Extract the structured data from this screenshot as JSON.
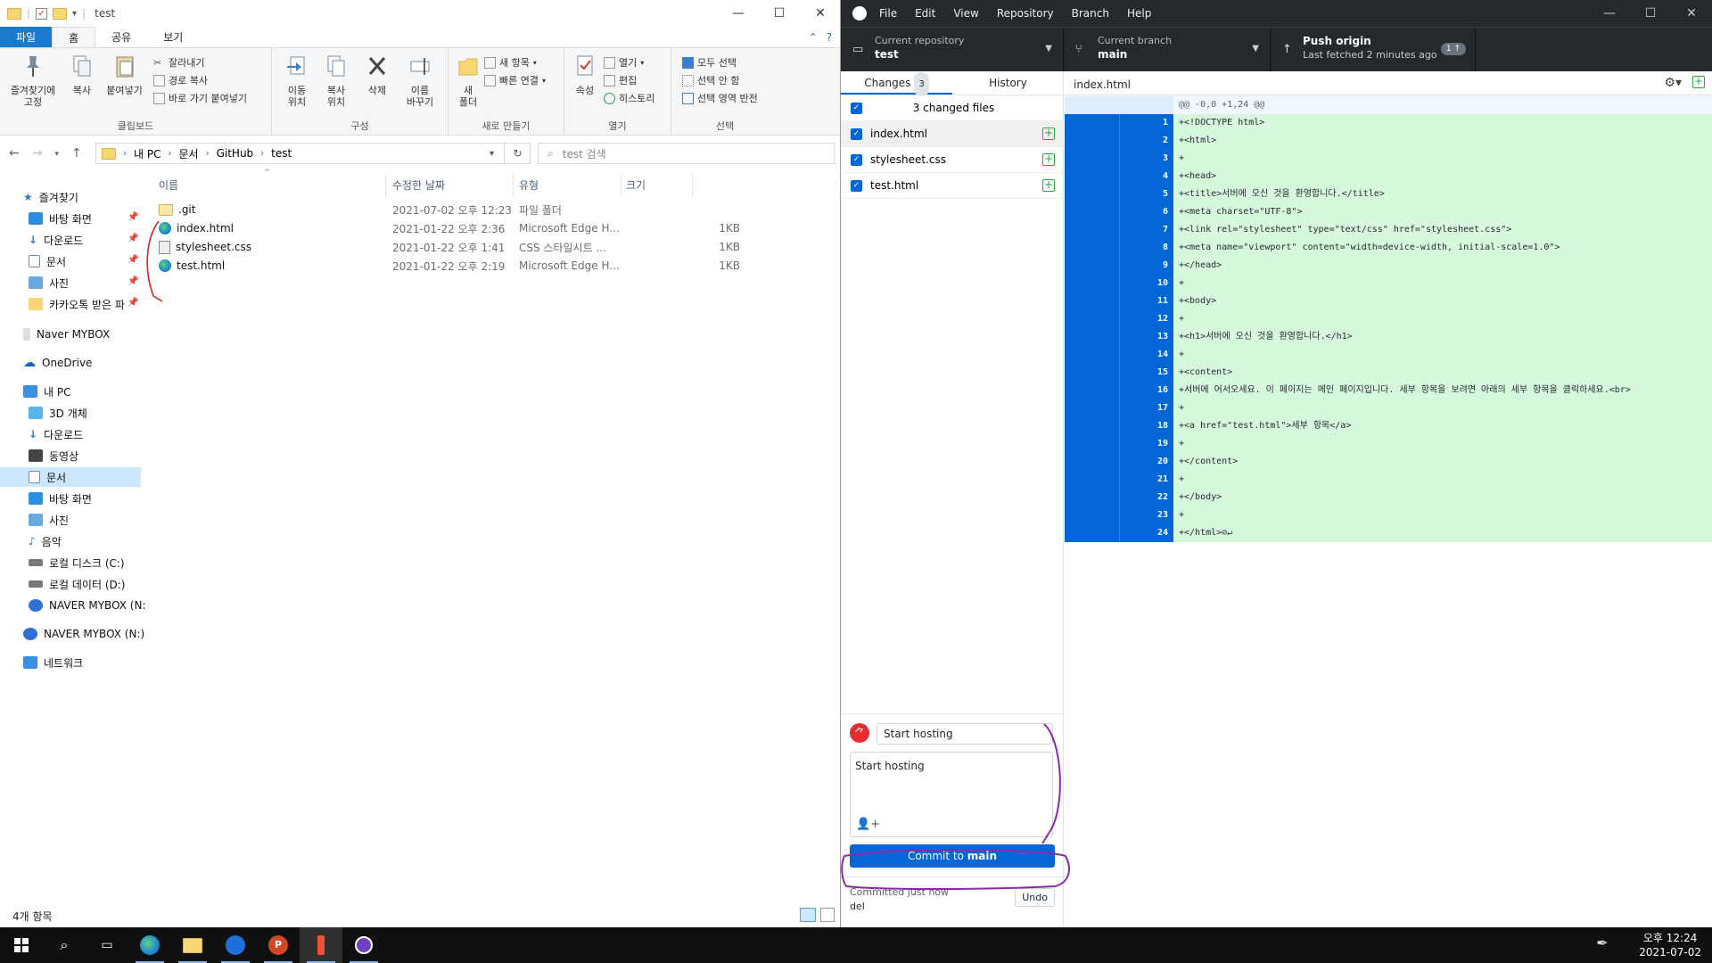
{
  "explorer": {
    "title": "test",
    "tabs": [
      "파일",
      "홈",
      "공유",
      "보기"
    ],
    "ribbon": {
      "clipboard": {
        "pin": "즐겨찾기에\n고정",
        "copy": "복사",
        "paste": "붙여넣기",
        "cut": "잘라내기",
        "copy_path": "경로 복사",
        "paste_shortcut": "바로 가기 붙여넣기",
        "label": "클립보드"
      },
      "organize": {
        "move": "이동\n위치",
        "copy_to": "복사\n위치",
        "delete": "삭제",
        "rename": "이름\n바꾸기",
        "label": "구성"
      },
      "new": {
        "new_folder": "새\n폴더",
        "new_item": "새 항목",
        "easy_access": "빠른 연결",
        "label": "새로 만들기"
      },
      "open": {
        "properties": "속성",
        "open": "열기",
        "edit": "편집",
        "history": "히스토리",
        "label": "열기"
      },
      "select": {
        "select_all": "모두 선택",
        "select_none": "선택 안 함",
        "invert": "선택 영역 반전",
        "label": "선택"
      }
    },
    "address": [
      "내 PC",
      "문서",
      "GitHub",
      "test"
    ],
    "search_placeholder": "test 검색",
    "nav": {
      "quick_access": "즐겨찾기",
      "pinned": [
        "바탕 화면",
        "다운로드",
        "문서",
        "사진",
        "카카오톡 받은 파"
      ],
      "naver_mybox": "Naver MYBOX",
      "onedrive": "OneDrive",
      "this_pc": "내 PC",
      "pc_items": [
        "3D 개체",
        "다운로드",
        "동영상",
        "문서",
        "바탕 화면",
        "사진",
        "음악",
        "로컬 디스크 (C:)",
        "로컬 데이터 (D:)",
        "NAVER MYBOX (N:"
      ],
      "naver_drive": "NAVER MYBOX (N:)",
      "network": "네트워크"
    },
    "columns": {
      "name": "이름",
      "modified": "수정한 날짜",
      "type": "유형",
      "size": "크기"
    },
    "files": [
      {
        "name": ".git",
        "modified": "2021-07-02 오후 12:23",
        "type": "파일 폴더",
        "size": ""
      },
      {
        "name": "index.html",
        "modified": "2021-01-22 오후 2:36",
        "type": "Microsoft Edge H...",
        "size": "1KB"
      },
      {
        "name": "stylesheet.css",
        "modified": "2021-01-22 오후 1:41",
        "type": "CSS 스타일시트 ...",
        "size": "1KB"
      },
      {
        "name": "test.html",
        "modified": "2021-01-22 오후 2:19",
        "type": "Microsoft Edge H...",
        "size": "1KB"
      }
    ],
    "status": "4개 항목"
  },
  "github": {
    "menu": [
      "File",
      "Edit",
      "View",
      "Repository",
      "Branch",
      "Help"
    ],
    "repo_label": "Current repository",
    "repo": "test",
    "branch_label": "Current branch",
    "branch": "main",
    "push_label": "Push origin",
    "push_sub": "Last fetched 2 minutes ago",
    "push_count": "1 ↑",
    "tabs": {
      "changes": "Changes",
      "changes_count": "3",
      "history": "History"
    },
    "changed_header": "3 changed files",
    "changed_files": [
      "index.html",
      "stylesheet.css",
      "test.html"
    ],
    "summary": "Start hosting",
    "description": "Start hosting",
    "commit_button_prefix": "Commit to",
    "commit_button_branch": "main",
    "committed_label": "Committed just now",
    "committed_msg": "del",
    "undo": "Undo",
    "diff_file": "index.html",
    "hunk": "@@ -0,0 +1,24 @@",
    "diff_lines": [
      "+<!DOCTYPE html>",
      "+<html>",
      "+",
      "+<head>",
      "+<title>서버에 오신 것을 환영합니다.</title>",
      "+<meta charset=\"UTF-8\">",
      "+<link rel=\"stylesheet\" type=\"text/css\" href=\"stylesheet.css\">",
      "+<meta name=\"viewport\" content=\"width=device-width, initial-scale=1.0\">",
      "+</head>",
      "+",
      "+<body>",
      "+",
      "+<h1>서버에 오신 것을 환영합니다.</h1>",
      "+",
      "+<content>",
      "+서버에 어서오세요. 이 페이지는 메인 페이지입니다. 세부 항목을 보려면 아래의 세부 항목을 클릭하세요.<br>",
      "+",
      "+<a href=\"test.html\">세부 항목</a>",
      "+",
      "+</content>",
      "+",
      "+</body>",
      "+",
      "+</html>⊘↵"
    ]
  },
  "taskbar": {
    "time": "오후 12:24",
    "date": "2021-07-02"
  },
  "colors": {
    "ribbon_file_tab": "#1979ca",
    "gh_dark": "#24292e",
    "gh_blue": "#0366d6",
    "diff_add": "#d6f9de",
    "annotation_purple": "#8a2aa8",
    "annotation_red": "#d62020"
  }
}
